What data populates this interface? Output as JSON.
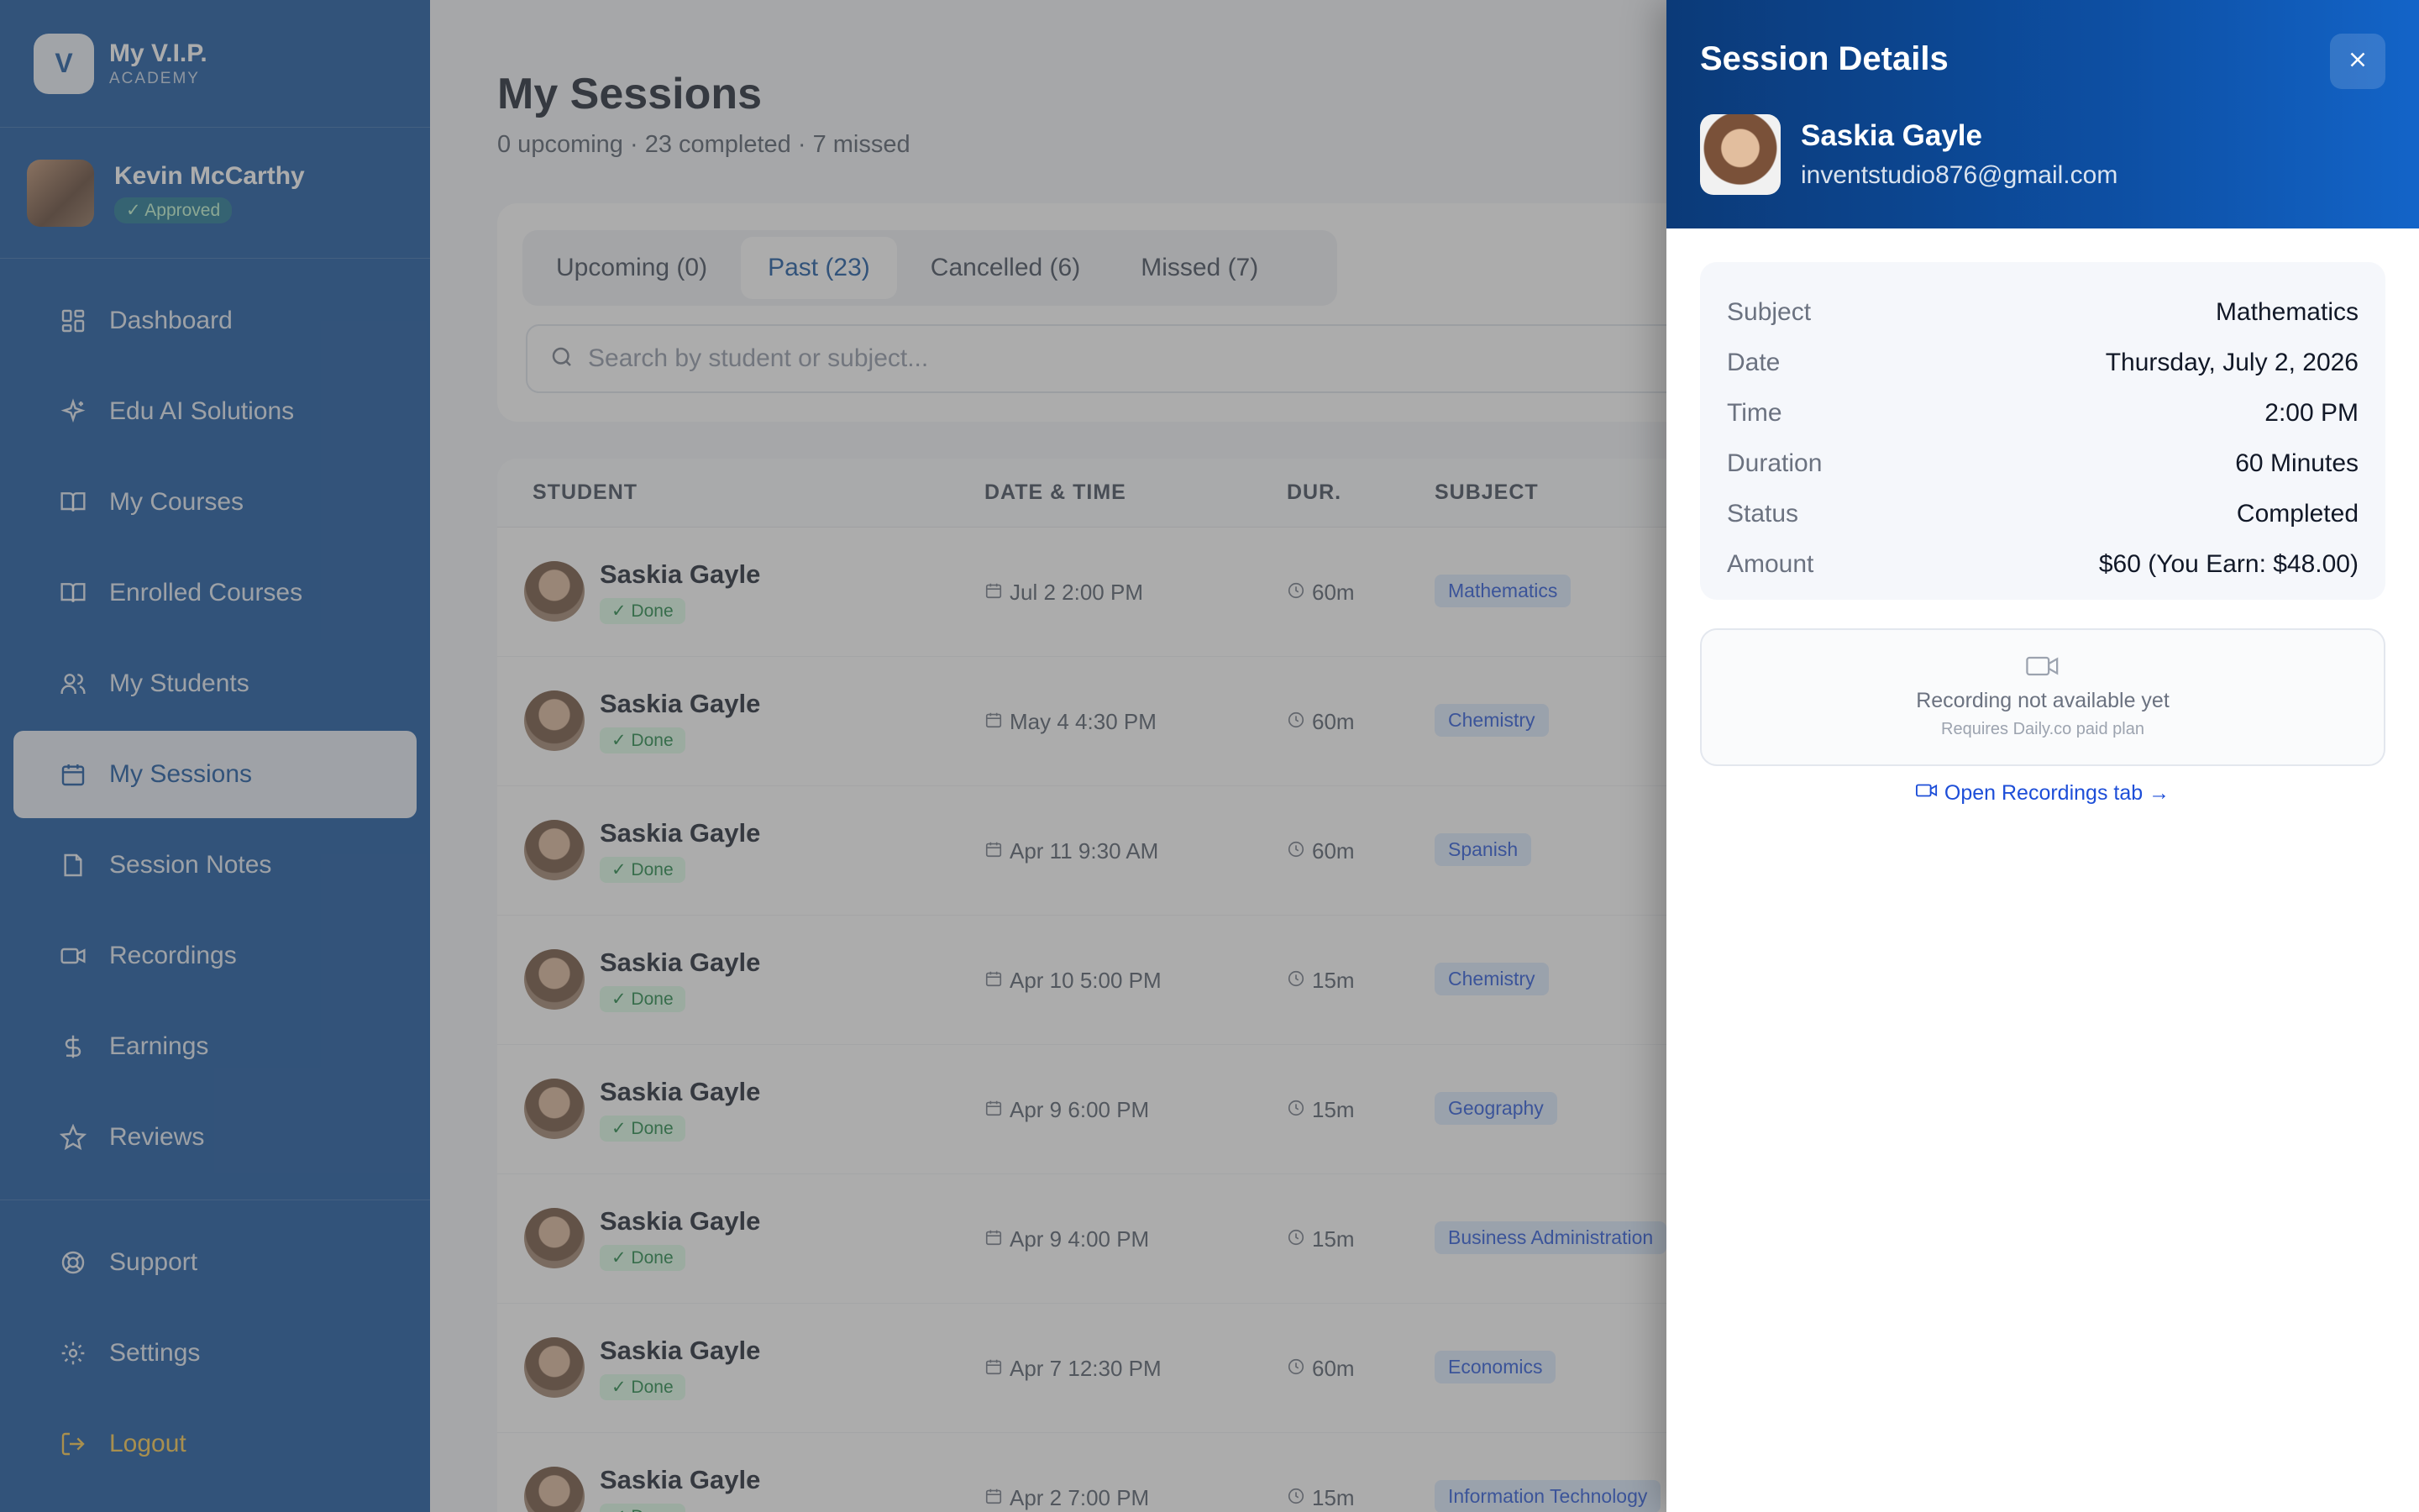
{
  "brand": {
    "logo_letter": "V",
    "name": "My V.I.P.",
    "sub": "ACADEMY"
  },
  "profile": {
    "name": "Kevin McCarthy",
    "badge": "✓ Approved"
  },
  "nav": {
    "dashboard": "Dashboard",
    "edu_ai": "Edu AI Solutions",
    "my_courses": "My Courses",
    "enrolled": "Enrolled Courses",
    "students": "My Students",
    "sessions": "My Sessions",
    "notes": "Session Notes",
    "recordings": "Recordings",
    "earnings": "Earnings",
    "reviews": "Reviews",
    "support": "Support",
    "settings": "Settings",
    "logout": "Logout"
  },
  "page": {
    "title": "My Sessions",
    "subtitle": "0 upcoming · 23 completed · 7 missed"
  },
  "tabs": [
    "Upcoming (0)",
    "Past (23)",
    "Cancelled (6)",
    "Missed (7)"
  ],
  "search": {
    "placeholder": "Search by student or subject..."
  },
  "table": {
    "headers": {
      "student": "STUDENT",
      "datetime": "DATE & TIME",
      "duration": "DUR.",
      "subject": "SUBJECT"
    },
    "rows": [
      {
        "name": "Saskia Gayle",
        "status": "✓ Done",
        "date": "Jul 2",
        "time": "2:00 PM",
        "duration": "60m",
        "subject": "Mathematics"
      },
      {
        "name": "Saskia Gayle",
        "status": "✓ Done",
        "date": "May 4",
        "time": "4:30 PM",
        "duration": "60m",
        "subject": "Chemistry"
      },
      {
        "name": "Saskia Gayle",
        "status": "✓ Done",
        "date": "Apr 11",
        "time": "9:30 AM",
        "duration": "60m",
        "subject": "Spanish"
      },
      {
        "name": "Saskia Gayle",
        "status": "✓ Done",
        "date": "Apr 10",
        "time": "5:00 PM",
        "duration": "15m",
        "subject": "Chemistry"
      },
      {
        "name": "Saskia Gayle",
        "status": "✓ Done",
        "date": "Apr 9",
        "time": "6:00 PM",
        "duration": "15m",
        "subject": "Geography"
      },
      {
        "name": "Saskia Gayle",
        "status": "✓ Done",
        "date": "Apr 9",
        "time": "4:00 PM",
        "duration": "15m",
        "subject": "Business Administration"
      },
      {
        "name": "Saskia Gayle",
        "status": "✓ Done",
        "date": "Apr 7",
        "time": "12:30 PM",
        "duration": "60m",
        "subject": "Economics"
      },
      {
        "name": "Saskia Gayle",
        "status": "✓ Done",
        "date": "Apr 2",
        "time": "7:00 PM",
        "duration": "15m",
        "subject": "Information Technology"
      }
    ]
  },
  "drawer": {
    "title": "Session Details",
    "student_name": "Saskia Gayle",
    "student_email": "inventstudio876@gmail.com",
    "details": [
      {
        "label": "Subject",
        "value": "Mathematics"
      },
      {
        "label": "Date",
        "value": "Thursday, July 2, 2026"
      },
      {
        "label": "Time",
        "value": "2:00 PM"
      },
      {
        "label": "Duration",
        "value": "60 Minutes"
      },
      {
        "label": "Status",
        "value": "Completed"
      },
      {
        "label": "Amount",
        "value": "$60 (You Earn: $48.00)"
      }
    ],
    "recording_text": "Recording not available yet",
    "recording_sub": "Requires Daily.co paid plan",
    "recordings_link": "Open Recordings tab →"
  },
  "colors": {
    "sidebar": "#0b4c9b",
    "accent": "#1d4ed8",
    "logout": "#f6c443",
    "done": "#15803d"
  }
}
